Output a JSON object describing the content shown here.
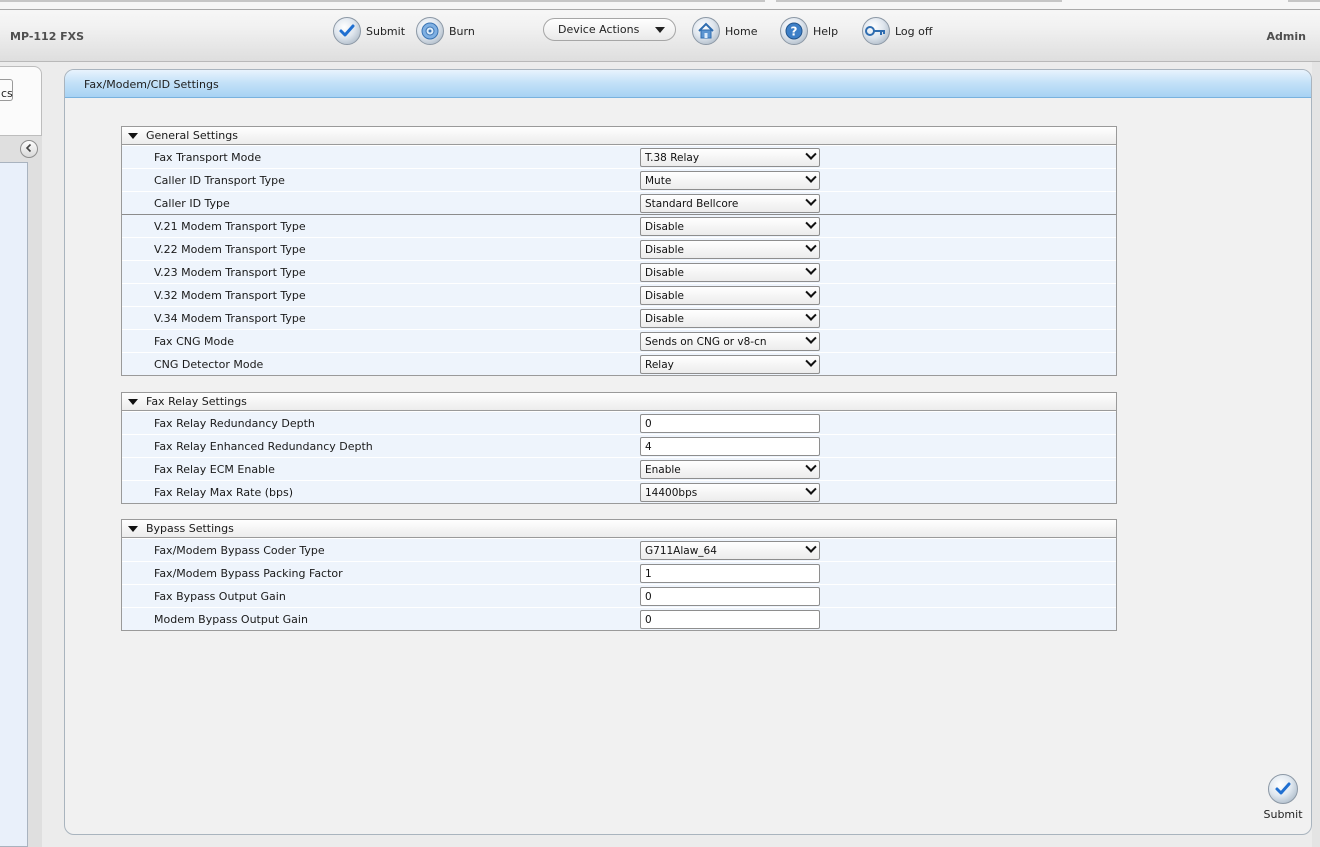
{
  "header": {
    "product_name": "MP-112 FXS",
    "user": "Admin",
    "toolbar": {
      "submit_label": "Submit",
      "burn_label": "Burn",
      "device_actions_label": "Device Actions",
      "home_label": "Home",
      "help_label": "Help",
      "logoff_label": "Log off"
    }
  },
  "left_nav": {
    "tab_text": "cs"
  },
  "page": {
    "title": "Fax/Modem/CID Settings",
    "submit_label": "Submit"
  },
  "sections": {
    "general": {
      "title": "General Settings",
      "rows": [
        {
          "label": "Fax Transport Mode",
          "value": "T.38 Relay"
        },
        {
          "label": "Caller ID Transport Type",
          "value": "Mute"
        },
        {
          "label": "Caller ID Type",
          "value": "Standard Bellcore"
        },
        {
          "label": "V.21 Modem Transport Type",
          "value": "Disable"
        },
        {
          "label": "V.22 Modem Transport Type",
          "value": "Disable"
        },
        {
          "label": "V.23 Modem Transport Type",
          "value": "Disable"
        },
        {
          "label": "V.32 Modem Transport Type",
          "value": "Disable"
        },
        {
          "label": "V.34 Modem Transport Type",
          "value": "Disable"
        },
        {
          "label": "Fax CNG Mode",
          "value": "Sends on CNG or v8-cn"
        },
        {
          "label": "CNG Detector Mode",
          "value": "Relay"
        }
      ]
    },
    "fax_relay": {
      "title": "Fax Relay Settings",
      "rows": [
        {
          "label": "Fax Relay Redundancy Depth",
          "value": "0"
        },
        {
          "label": "Fax Relay Enhanced Redundancy Depth",
          "value": "4"
        },
        {
          "label": "Fax Relay ECM Enable",
          "value": "Enable"
        },
        {
          "label": "Fax Relay Max Rate (bps)",
          "value": "14400bps"
        }
      ]
    },
    "bypass": {
      "title": "Bypass Settings",
      "rows": [
        {
          "label": "Fax/Modem Bypass Coder Type",
          "value": "G711Alaw_64"
        },
        {
          "label": "Fax/Modem Bypass Packing Factor",
          "value": "1"
        },
        {
          "label": "Fax Bypass Output Gain",
          "value": "0"
        },
        {
          "label": "Modem Bypass Output Gain",
          "value": "0"
        }
      ]
    }
  },
  "icons": {
    "submit": "check-icon",
    "burn": "burn-disc-icon",
    "home": "home-icon",
    "help": "help-icon",
    "logoff": "key-icon",
    "collapse": "chevron-left-icon",
    "section_toggle": "triangle-down-icon"
  },
  "colors": {
    "header_blue": "#a7d2f3",
    "row_background": "#eef4fc",
    "check_blue": "#1f6fd1"
  }
}
